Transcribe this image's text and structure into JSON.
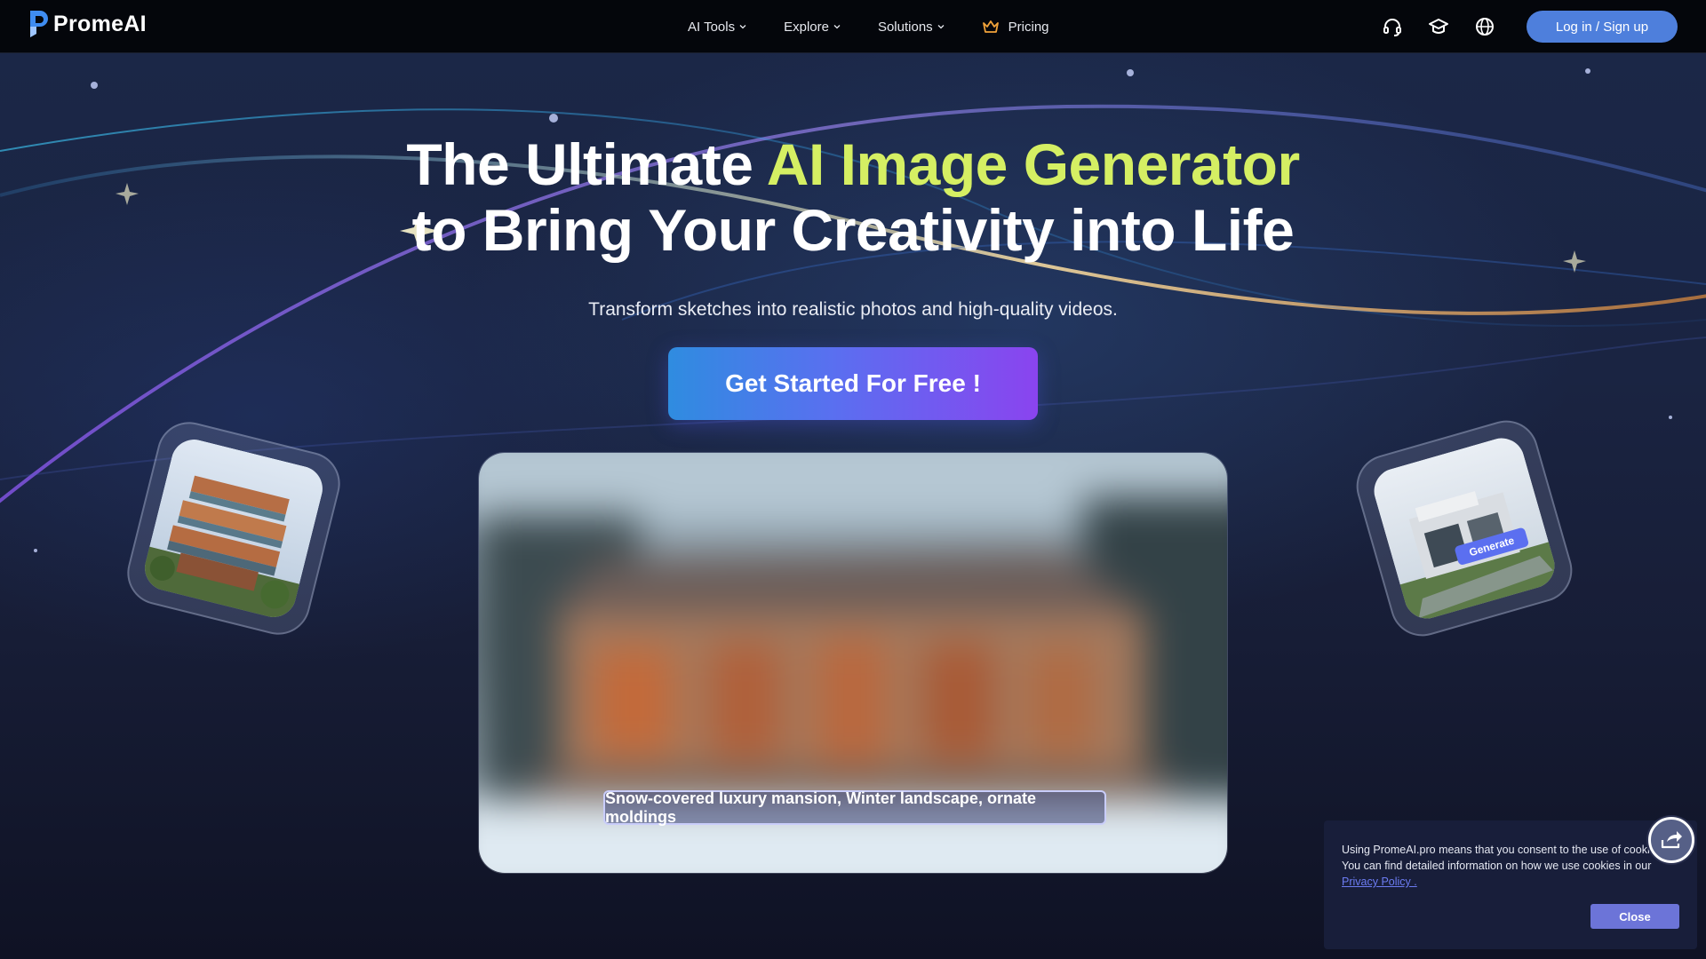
{
  "header": {
    "logo_text": "PromeAI",
    "nav": [
      {
        "label": "AI Tools",
        "icon": "chevron-down-icon"
      },
      {
        "label": "Explore",
        "icon": "chevron-down-icon"
      },
      {
        "label": "Solutions",
        "icon": "chevron-down-icon"
      },
      {
        "label": "Pricing",
        "icon": "crown-icon"
      }
    ],
    "icons": [
      "headset-icon",
      "graduation-cap-icon",
      "globe-icon"
    ],
    "login_label": "Log in / Sign up"
  },
  "hero": {
    "title_part1": "The Ultimate ",
    "title_highlight": "AI Image Generator",
    "title_line2": "to Bring Your Creativity into Life",
    "subtitle": "Transform sketches into realistic photos and high-quality videos.",
    "cta_label": "Get Started For Free !"
  },
  "side_tiles": {
    "right_tag": "Generate"
  },
  "preview": {
    "prompt": "Snow-covered luxury mansion, Winter landscape, ornate moldings"
  },
  "cookie": {
    "text": "Using PromeAI.pro means that you consent to the use of cookies. You can find detailed information on how we use cookies in our ",
    "link": "Privacy Policy .",
    "close_label": "Close"
  },
  "colors": {
    "header_bg": "#04060b",
    "accent_blue": "#4e7fdc",
    "highlight_green": "#d5ef63",
    "cta_start": "#2f8ce0",
    "cta_end": "#8a44ef",
    "cookie_bg": "#181e3a"
  }
}
